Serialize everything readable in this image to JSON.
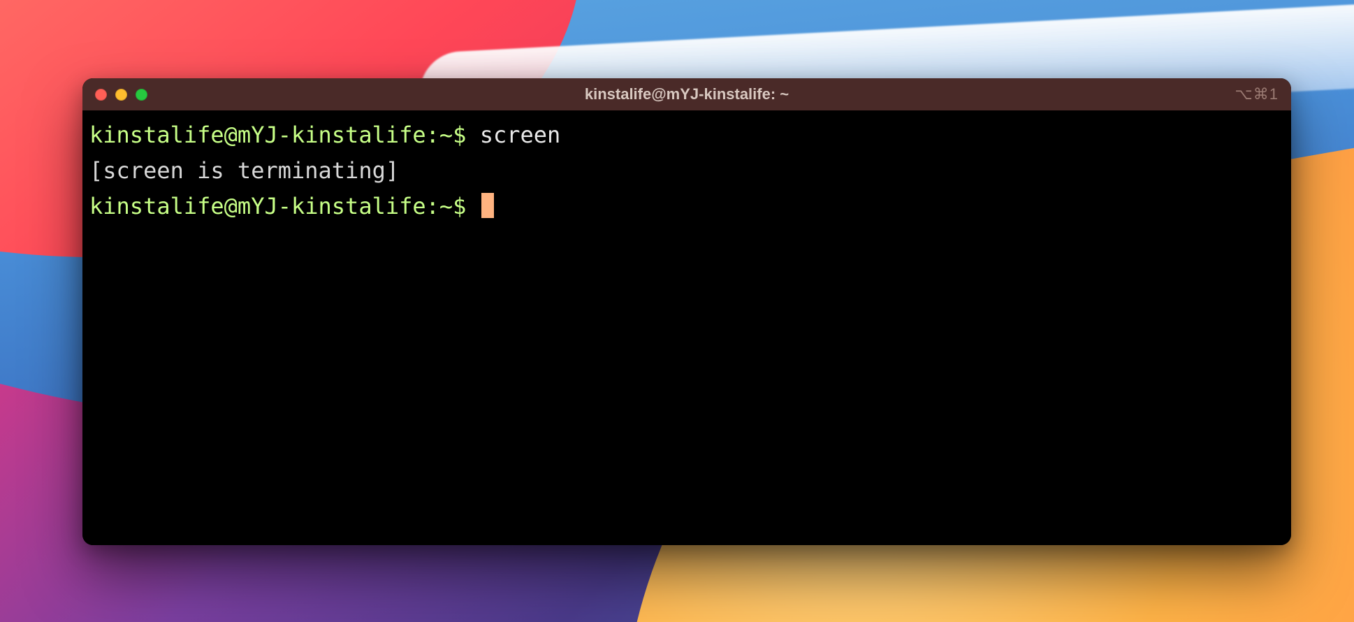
{
  "window": {
    "title": "kinstalife@mYJ-kinstalife: ~",
    "shortcut": "⌥⌘1"
  },
  "terminal": {
    "lines": [
      {
        "prompt": "kinstalife@mYJ-kinstalife:~$ ",
        "command": "screen"
      },
      {
        "output": "[screen is terminating]"
      },
      {
        "prompt": "kinstalife@mYJ-kinstalife:~$ ",
        "cursor": true
      }
    ]
  }
}
